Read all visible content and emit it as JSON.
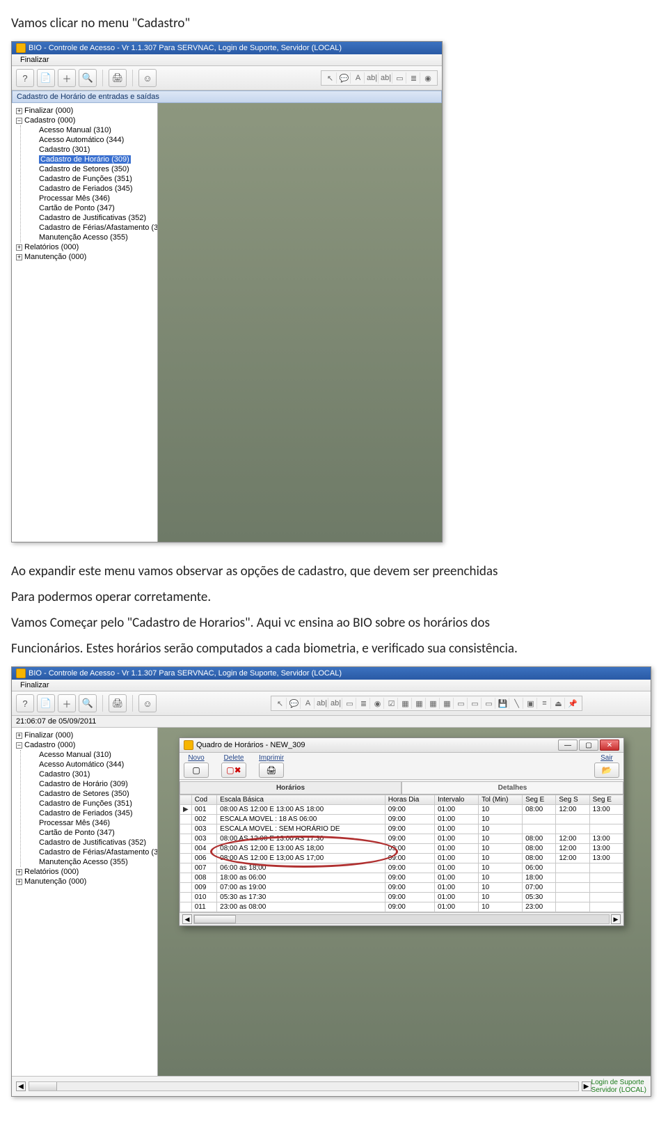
{
  "doc": {
    "p1": "Vamos clicar no menu \"Cadastro\"",
    "p2": "Ao expandir este menu vamos observar as opções de cadastro, que devem ser preenchidas",
    "p3": "Para podermos operar corretamente.",
    "p4": "Vamos Começar pelo \"Cadastro de Horarios\". Aqui vc ensina ao BIO sobre os horários dos",
    "p5": "Funcionários. Estes horários serão computados a cada biometria, e verificado sua consistência."
  },
  "app1": {
    "title": "BIO - Controle de Acesso - Vr 1.1.307 Para SERVNAC, Login de Suporte, Servidor (LOCAL)",
    "menu_finalizar": "Finalizar",
    "panel_title": "Cadastro de Horário de entradas e saídas",
    "tree": {
      "finalizar": "Finalizar (000)",
      "cadastro": "Cadastro (000)",
      "children": [
        "Acesso Manual (310)",
        "Acesso Automático (344)",
        "Cadastro (301)",
        "Cadastro de Horário (309)",
        "Cadastro de Setores (350)",
        "Cadastro de Funções (351)",
        "Cadastro de Feriados (345)",
        "Processar Mês (346)",
        "Cartão de Ponto (347)",
        "Cadastro de Justificativas (352)",
        "Cadastro de Férias/Afastamento (3",
        "Manutenção Acesso (355)"
      ],
      "selected_index": 3,
      "relatorios": "Relatórios (000)",
      "manutencao": "Manutenção (000)"
    }
  },
  "app2": {
    "title": "BIO - Controle de Acesso - Vr 1.1.307 Para SERVNAC, Login de Suporte, Servidor (LOCAL)",
    "menu_finalizar": "Finalizar",
    "status_time": "21:06:07 de 05/09/2011",
    "tree": {
      "finalizar": "Finalizar (000)",
      "cadastro": "Cadastro (000)",
      "children": [
        "Acesso Manual (310)",
        "Acesso Automático (344)",
        "Cadastro (301)",
        "Cadastro de Horário (309)",
        "Cadastro de Setores (350)",
        "Cadastro de Funções (351)",
        "Cadastro de Feriados (345)",
        "Processar Mês (346)",
        "Cartão de Ponto (347)",
        "Cadastro de Justificativas (352)",
        "Cadastro de Férias/Afastamento (3",
        "Manutenção Acesso (355)"
      ],
      "relatorios": "Relatórios (000)",
      "manutencao": "Manutenção (000)"
    },
    "subwin": {
      "title": "Quadro de Horários - NEW_309",
      "btn_novo": "Novo",
      "btn_delete": "Delete",
      "btn_imprimir": "Imprimir",
      "btn_sair": "Sair",
      "tab_horarios": "Horários",
      "tab_detalhes": "Detalhes",
      "cols": [
        "",
        "Cod",
        "Escala Básica",
        "Horas Dia",
        "Intervalo",
        "Tol (Min)",
        "Seg E",
        "Seg S",
        "Seg E"
      ],
      "rows": [
        {
          "ptr": "▶",
          "cod": "001",
          "esc": "08:00 AS 12:00 E 13:00 AS 18:00",
          "hd": "09:00",
          "int": "01:00",
          "tol": "10",
          "a": "08:00",
          "b": "12:00",
          "c": "13:00"
        },
        {
          "ptr": "",
          "cod": "002",
          "esc": "ESCALA MOVEL : 18 AS 06:00",
          "hd": "09:00",
          "int": "01:00",
          "tol": "10",
          "a": "",
          "b": "",
          "c": ""
        },
        {
          "ptr": "",
          "cod": "003",
          "esc": "ESCALA MOVEL : SEM HORÁRIO DE",
          "hd": "09:00",
          "int": "01:00",
          "tol": "10",
          "a": "",
          "b": "",
          "c": ""
        },
        {
          "ptr": "",
          "cod": "003",
          "esc": "08:00 AS 12:00 E 13:00 AS 17:30",
          "hd": "09:00",
          "int": "01:00",
          "tol": "10",
          "a": "08:00",
          "b": "12:00",
          "c": "13:00"
        },
        {
          "ptr": "",
          "cod": "004",
          "esc": "08;00 AS 12;00 E 13:00 AS 18;00",
          "hd": "09:00",
          "int": "01:00",
          "tol": "10",
          "a": "08:00",
          "b": "12:00",
          "c": "13:00"
        },
        {
          "ptr": "",
          "cod": "006",
          "esc": "08;00 AS 12:00 E 13;00 AS 17;00",
          "hd": "09:00",
          "int": "01:00",
          "tol": "10",
          "a": "08:00",
          "b": "12:00",
          "c": "13:00"
        },
        {
          "ptr": "",
          "cod": "007",
          "esc": "06:00 as 18;00",
          "hd": "09:00",
          "int": "01:00",
          "tol": "10",
          "a": "06:00",
          "b": "",
          "c": ""
        },
        {
          "ptr": "",
          "cod": "008",
          "esc": "18:00 as 06:00",
          "hd": "09:00",
          "int": "01:00",
          "tol": "10",
          "a": "18:00",
          "b": "",
          "c": ""
        },
        {
          "ptr": "",
          "cod": "009",
          "esc": "07:00 as 19:00",
          "hd": "09:00",
          "int": "01:00",
          "tol": "10",
          "a": "07:00",
          "b": "",
          "c": ""
        },
        {
          "ptr": "",
          "cod": "010",
          "esc": "05:30 as 17:30",
          "hd": "09:00",
          "int": "01:00",
          "tol": "10",
          "a": "05:30",
          "b": "",
          "c": ""
        },
        {
          "ptr": "",
          "cod": "011",
          "esc": "23:00 as 08:00",
          "hd": "09:00",
          "int": "01:00",
          "tol": "10",
          "a": "23:00",
          "b": "",
          "c": ""
        }
      ]
    },
    "login_label": "Login de   Suporte",
    "servidor_label": "Servidor  (LOCAL)"
  }
}
